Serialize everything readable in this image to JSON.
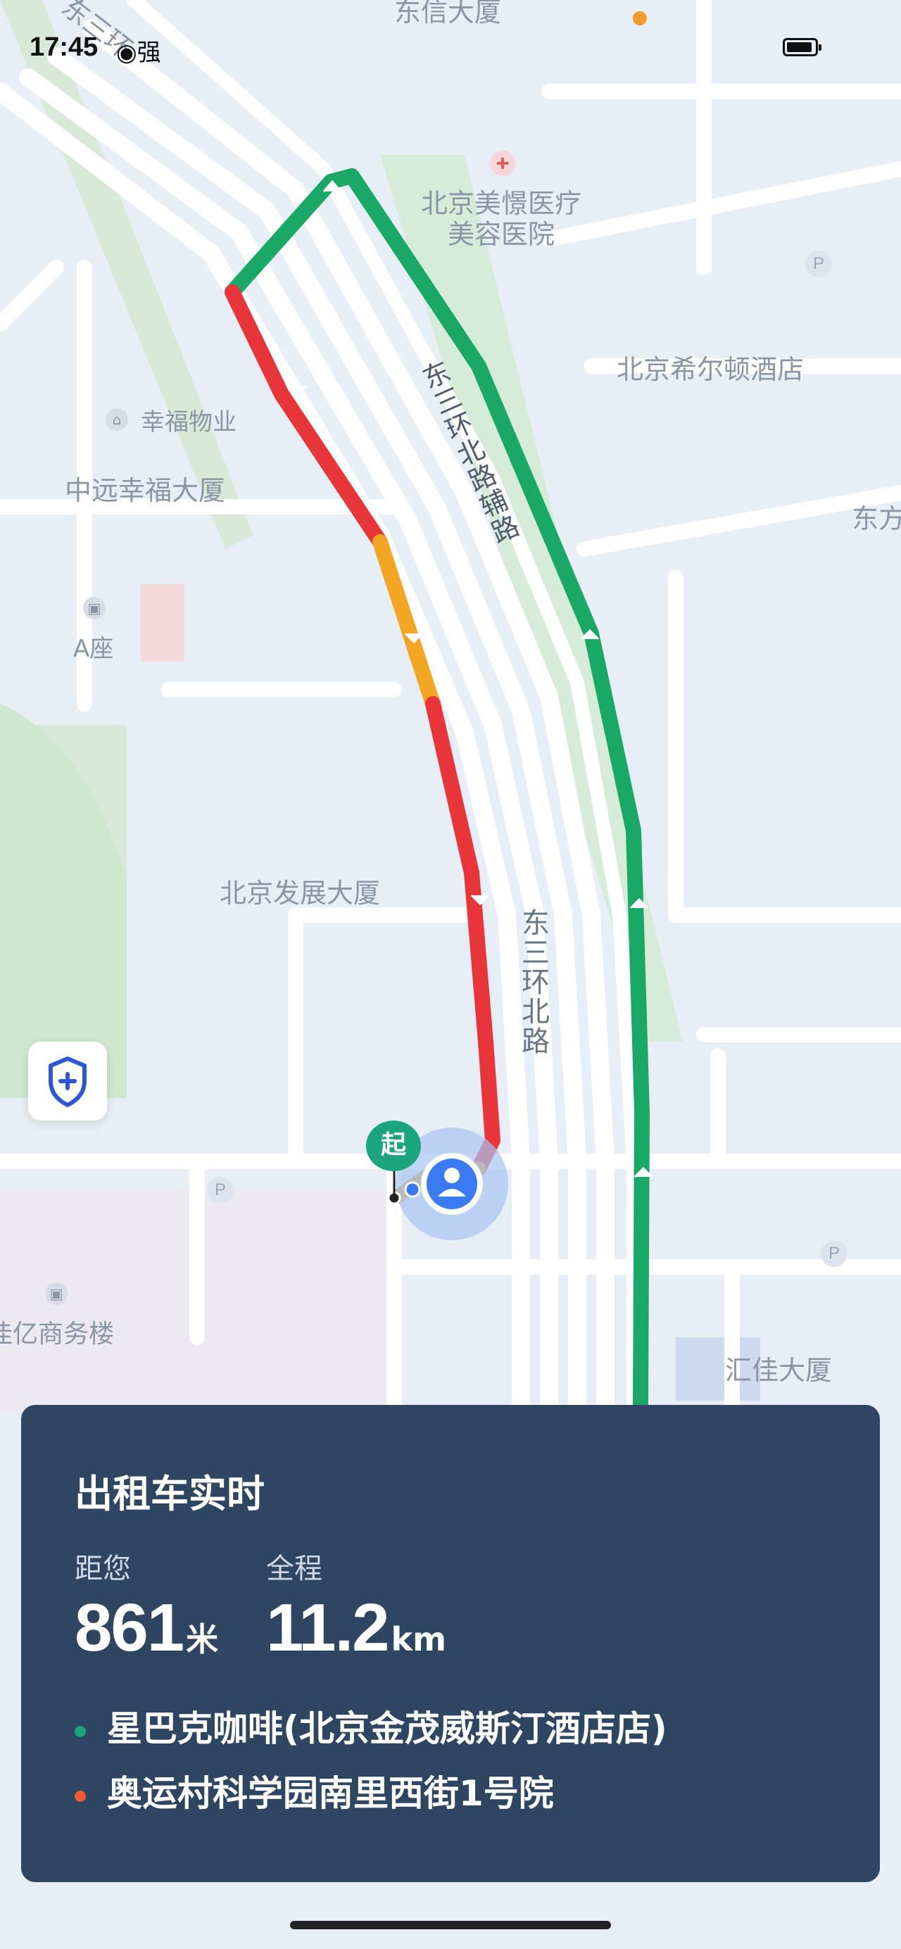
{
  "status_bar": {
    "time": "17:45",
    "signal": "强"
  },
  "map": {
    "labels": {
      "road_top": "东三环",
      "building_top": "东信大厦",
      "hospital": "北京美憬医疗美容医院",
      "hospital_line1": "北京美憬医疗",
      "hospital_line2": "美容医院",
      "hilton": "北京希尔顿酒店",
      "xingfu_property": "幸福物业",
      "zhongyuan": "中远幸福大厦",
      "a_tower": "A座",
      "fazhan": "北京发展大厦",
      "jiayi": "佳亿商务楼",
      "huijia": "汇佳大厦",
      "fulu": "东三环北路辅路",
      "east_road": "东三环北路",
      "east_edge": "东方",
      "parking": "P"
    }
  },
  "start_marker": {
    "label": "起"
  },
  "card": {
    "title": "出租车实时",
    "distance_label": "距您",
    "distance_value": "861",
    "distance_unit": "米",
    "total_label": "全程",
    "total_value": "11.2",
    "total_unit": "km",
    "origin": "星巴克咖啡(北京金茂威斯汀酒店店)",
    "destination": "奥运村科学园南里西街1号院"
  },
  "colors": {
    "route_clear": "#1aa866",
    "route_jam": "#e8353a",
    "route_slow": "#f3a623",
    "origin_dot": "#1aa57d",
    "dest_dot": "#ee5a36",
    "card_bg": "#2f4663"
  }
}
